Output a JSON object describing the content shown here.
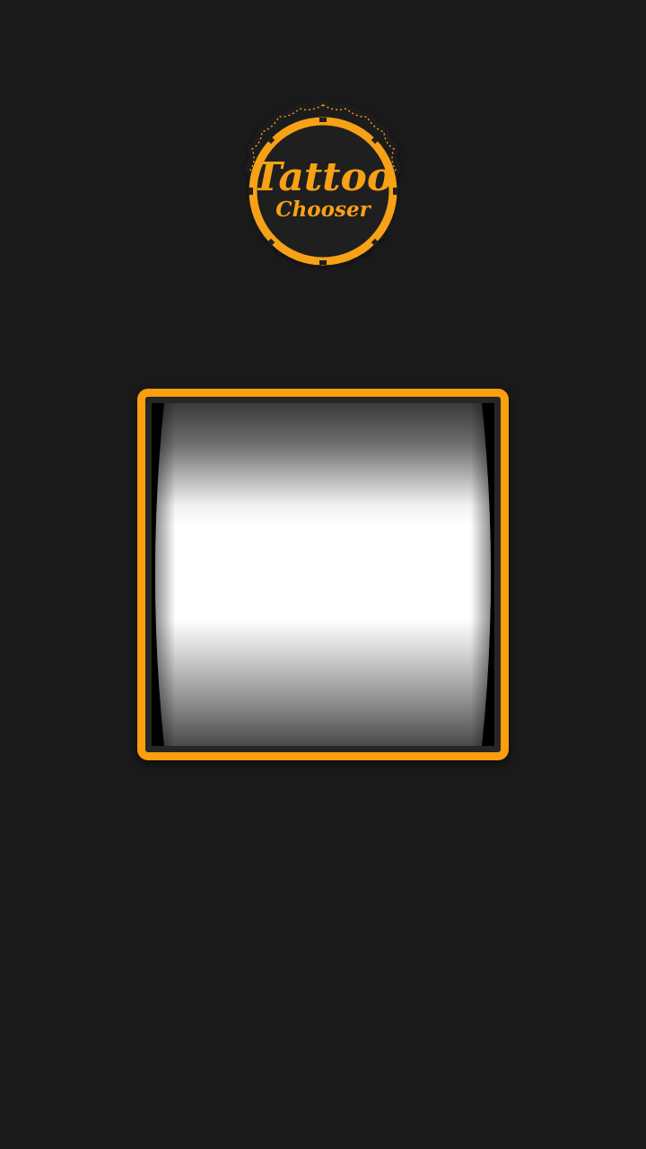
{
  "logo": {
    "title": "Tattoo",
    "subtitle": "Chooser",
    "accent_color": "#f7a116",
    "badge_color": "#1f1f1f"
  },
  "reel": {
    "frame_color": "#fb9e0f",
    "icon": "slot-reel-drum"
  },
  "colors": {
    "background": "#1a1a1a"
  }
}
